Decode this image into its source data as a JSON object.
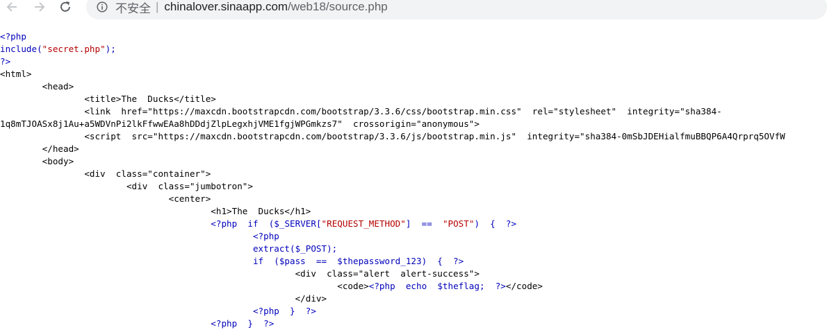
{
  "browser": {
    "security_label": "不安全",
    "separator": "|",
    "url_host": "chinalover.sinaapp.com",
    "url_path": "/web18/source.php"
  },
  "source_lines": [
    [
      {
        "t": "<?php",
        "c": "php"
      }
    ],
    [
      {
        "t": "include(",
        "c": "php"
      },
      {
        "t": "\"secret.php\"",
        "c": "str"
      },
      {
        "t": ");",
        "c": "php"
      }
    ],
    [
      {
        "t": "?>",
        "c": "php"
      }
    ],
    [
      {
        "t": "<html>",
        "c": "html"
      }
    ],
    [
      {
        "t": "        <head>",
        "c": "html"
      }
    ],
    [
      {
        "t": "                <title>The  Ducks</title>",
        "c": "html"
      }
    ],
    [
      {
        "t": "                <link  href=\"https://maxcdn.bootstrapcdn.com/bootstrap/3.3.6/css/bootstrap.min.css\"  rel=\"stylesheet\"  integrity=\"sha384-",
        "c": "html"
      }
    ],
    [
      {
        "t": "1q8mTJOASx8j1Au+a5WDVnPi2lkFfwwEAa8hDDdjZlpLegxhjVME1fgjWPGmkzs7\"  crossorigin=\"anonymous\">",
        "c": "html"
      }
    ],
    [
      {
        "t": "                <script  src=\"https://maxcdn.bootstrapcdn.com/bootstrap/3.3.6/js/bootstrap.min.js\"  integrity=\"sha384-0mSbJDEHialfmuBBQP6A4Qrprq5OVfW",
        "c": "html"
      }
    ],
    [
      {
        "t": "        </head>",
        "c": "html"
      }
    ],
    [
      {
        "t": "        <body>",
        "c": "html"
      }
    ],
    [
      {
        "t": "                <div  class=\"container\">",
        "c": "html"
      }
    ],
    [
      {
        "t": "                        <div  class=\"jumbotron\">",
        "c": "html"
      }
    ],
    [
      {
        "t": "                                <center>",
        "c": "html"
      }
    ],
    [
      {
        "t": "                                        <h1>The  Ducks</h1>",
        "c": "html"
      }
    ],
    [
      {
        "t": "                                        ",
        "c": "html"
      },
      {
        "t": "<?php  if  ($_SERVER[",
        "c": "php"
      },
      {
        "t": "\"REQUEST_METHOD\"",
        "c": "str"
      },
      {
        "t": "]  ==  ",
        "c": "php"
      },
      {
        "t": "\"POST\"",
        "c": "str"
      },
      {
        "t": ")  {  ?>",
        "c": "php"
      }
    ],
    [
      {
        "t": "                                                ",
        "c": "html"
      },
      {
        "t": "<?php",
        "c": "php"
      }
    ],
    [
      {
        "t": "                                                extract($_POST);",
        "c": "php"
      }
    ],
    [
      {
        "t": "                                                if  ($pass  ==  $thepassword_123)  {  ?>",
        "c": "php"
      }
    ],
    [
      {
        "t": "                                                        <div  class=\"alert  alert-success\">",
        "c": "html"
      }
    ],
    [
      {
        "t": "                                                                <code>",
        "c": "html"
      },
      {
        "t": "<?php  echo  $theflag;  ?>",
        "c": "php"
      },
      {
        "t": "</code>",
        "c": "html"
      }
    ],
    [
      {
        "t": "                                                        </div>",
        "c": "html"
      }
    ],
    [
      {
        "t": "                                                ",
        "c": "html"
      },
      {
        "t": "<?php  }  ?>",
        "c": "php"
      }
    ],
    [
      {
        "t": "                                        ",
        "c": "html"
      },
      {
        "t": "<?php  }  ?>",
        "c": "php"
      }
    ]
  ]
}
